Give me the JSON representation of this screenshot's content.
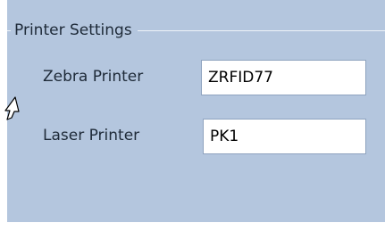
{
  "group": {
    "title": "Printer Settings"
  },
  "fields": [
    {
      "label": "Zebra Printer",
      "value": "ZRFID77"
    },
    {
      "label": "Laser Printer",
      "value": "PK1"
    }
  ],
  "colors": {
    "panel_background": "#b4c6de",
    "input_background": "#ffffff",
    "text": "#1e2a38"
  },
  "icons": {
    "cursor": "mouse-pointer-icon"
  }
}
